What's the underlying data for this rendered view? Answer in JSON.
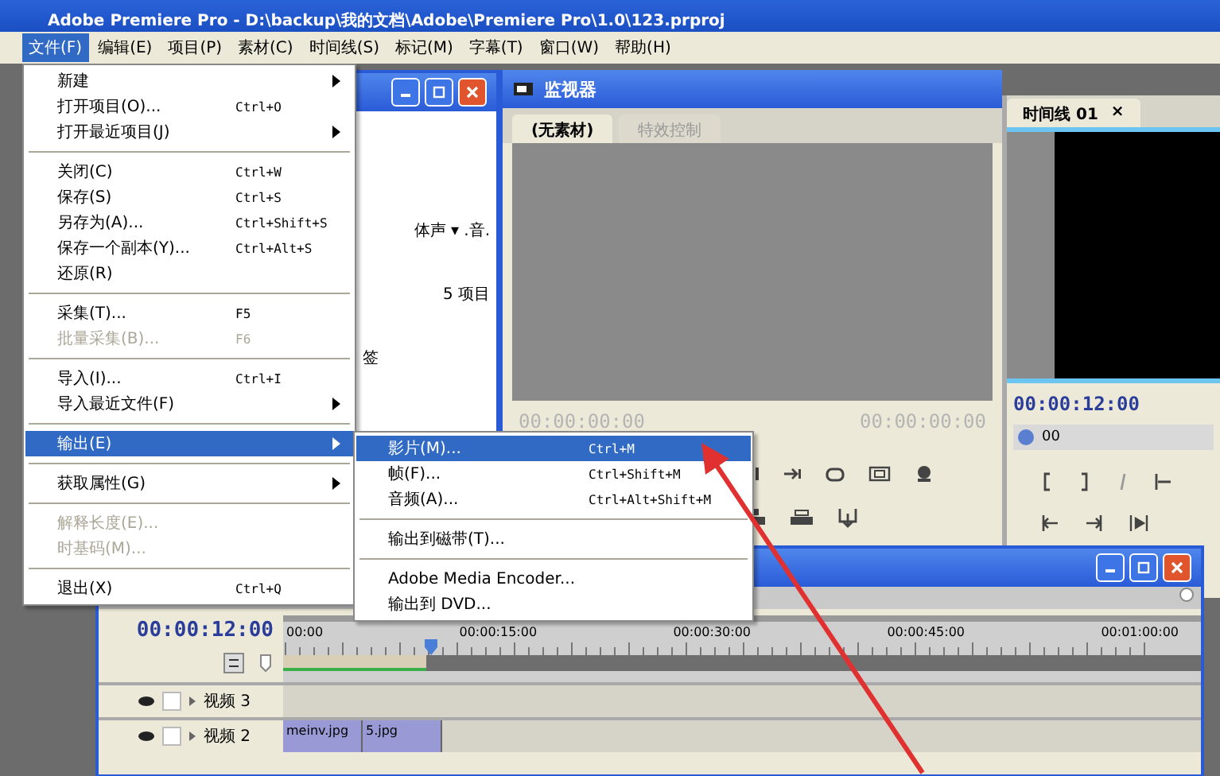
{
  "window": {
    "title": "Adobe Premiere Pro - D:\\backup\\我的文档\\Adobe\\Premiere Pro\\1.0\\123.prproj"
  },
  "menu_bar": [
    {
      "label": "文件(F)",
      "selected": true
    },
    {
      "label": "编辑(E)",
      "selected": false
    },
    {
      "label": "项目(P)",
      "selected": false
    },
    {
      "label": "素材(C)",
      "selected": false
    },
    {
      "label": "时间线(S)",
      "selected": false
    },
    {
      "label": "标记(M)",
      "selected": false
    },
    {
      "label": "字幕(T)",
      "selected": false
    },
    {
      "label": "窗口(W)",
      "selected": false
    },
    {
      "label": "帮助(H)",
      "selected": false
    }
  ],
  "file_menu": [
    {
      "kind": "item",
      "label": "新建",
      "submenu": true,
      "disabled": false,
      "selected": false
    },
    {
      "kind": "item",
      "label": "打开项目(O)...",
      "shortcut": "Ctrl+O",
      "submenu": false,
      "disabled": false,
      "selected": false
    },
    {
      "kind": "item",
      "label": "打开最近项目(J)",
      "submenu": true,
      "disabled": false,
      "selected": false
    },
    {
      "kind": "separator"
    },
    {
      "kind": "item",
      "label": "关闭(C)",
      "shortcut": "Ctrl+W",
      "submenu": false,
      "disabled": false,
      "selected": false
    },
    {
      "kind": "item",
      "label": "保存(S)",
      "shortcut": "Ctrl+S",
      "submenu": false,
      "disabled": false,
      "selected": false
    },
    {
      "kind": "item",
      "label": "另存为(A)...",
      "shortcut": "Ctrl+Shift+S",
      "submenu": false,
      "disabled": false,
      "selected": false
    },
    {
      "kind": "item",
      "label": "保存一个副本(Y)...",
      "shortcut": "Ctrl+Alt+S",
      "submenu": false,
      "disabled": false,
      "selected": false
    },
    {
      "kind": "item",
      "label": "还原(R)",
      "submenu": false,
      "disabled": false,
      "selected": false
    },
    {
      "kind": "separator"
    },
    {
      "kind": "item",
      "label": "采集(T)...",
      "shortcut": "F5",
      "submenu": false,
      "disabled": false,
      "selected": false
    },
    {
      "kind": "item",
      "label": "批量采集(B)...",
      "shortcut": "F6",
      "submenu": false,
      "disabled": true,
      "selected": false
    },
    {
      "kind": "separator"
    },
    {
      "kind": "item",
      "label": "导入(I)...",
      "shortcut": "Ctrl+I",
      "submenu": false,
      "disabled": false,
      "selected": false
    },
    {
      "kind": "item",
      "label": "导入最近文件(F)",
      "submenu": true,
      "disabled": false,
      "selected": false
    },
    {
      "kind": "separator"
    },
    {
      "kind": "item",
      "label": "输出(E)",
      "submenu": true,
      "disabled": false,
      "selected": true
    },
    {
      "kind": "separator"
    },
    {
      "kind": "item",
      "label": "获取属性(G)",
      "submenu": true,
      "disabled": false,
      "selected": false
    },
    {
      "kind": "separator"
    },
    {
      "kind": "item",
      "label": "解释长度(E)...",
      "submenu": false,
      "disabled": true,
      "selected": false
    },
    {
      "kind": "item",
      "label": "时基码(M)...",
      "submenu": false,
      "disabled": true,
      "selected": false
    },
    {
      "kind": "separator"
    },
    {
      "kind": "item",
      "label": "退出(X)",
      "shortcut": "Ctrl+Q",
      "submenu": false,
      "disabled": false,
      "selected": false
    }
  ],
  "export_submenu": [
    {
      "kind": "item",
      "label": "影片(M)...",
      "shortcut": "Ctrl+M",
      "disabled": false,
      "selected": true
    },
    {
      "kind": "item",
      "label": "帧(F)...",
      "shortcut": "Ctrl+Shift+M",
      "disabled": false,
      "selected": false
    },
    {
      "kind": "item",
      "label": "音频(A)...",
      "shortcut": "Ctrl+Alt+Shift+M",
      "disabled": false,
      "selected": false
    },
    {
      "kind": "separator"
    },
    {
      "kind": "item",
      "label": "输出到磁带(T)...",
      "disabled": false,
      "selected": false
    },
    {
      "kind": "separator"
    },
    {
      "kind": "item",
      "label": "Adobe Media Encoder...",
      "disabled": false,
      "selected": false
    },
    {
      "kind": "item",
      "label": "输出到 DVD...",
      "disabled": false,
      "selected": false
    }
  ],
  "project_panel": {
    "audio_label": "体声 ▾ .音.",
    "item_count": "5 项目",
    "column_header": "签"
  },
  "monitor": {
    "title": "监视器",
    "tabs": [
      {
        "label": "(无素材)",
        "selected": true
      },
      {
        "label": "特效控制",
        "selected": false
      }
    ],
    "source_timecode": "00:00:00:00",
    "program_timecode": "00:00:00:00"
  },
  "timeline_panel": {
    "tab": "时间线 01",
    "close": "×",
    "timecode": "00:00:12:00",
    "zoom_label": "00"
  },
  "timeline_window": {
    "timecode": "00:00:12:00",
    "ruler": [
      "00:00",
      "00:00:15:00",
      "00:00:30:00",
      "00:00:45:00",
      "00:01:00:00"
    ],
    "tracks": [
      {
        "name": "视频 3"
      },
      {
        "name": "视频 2",
        "clips": [
          "meinv.jpg",
          "5.jpg"
        ]
      }
    ]
  }
}
